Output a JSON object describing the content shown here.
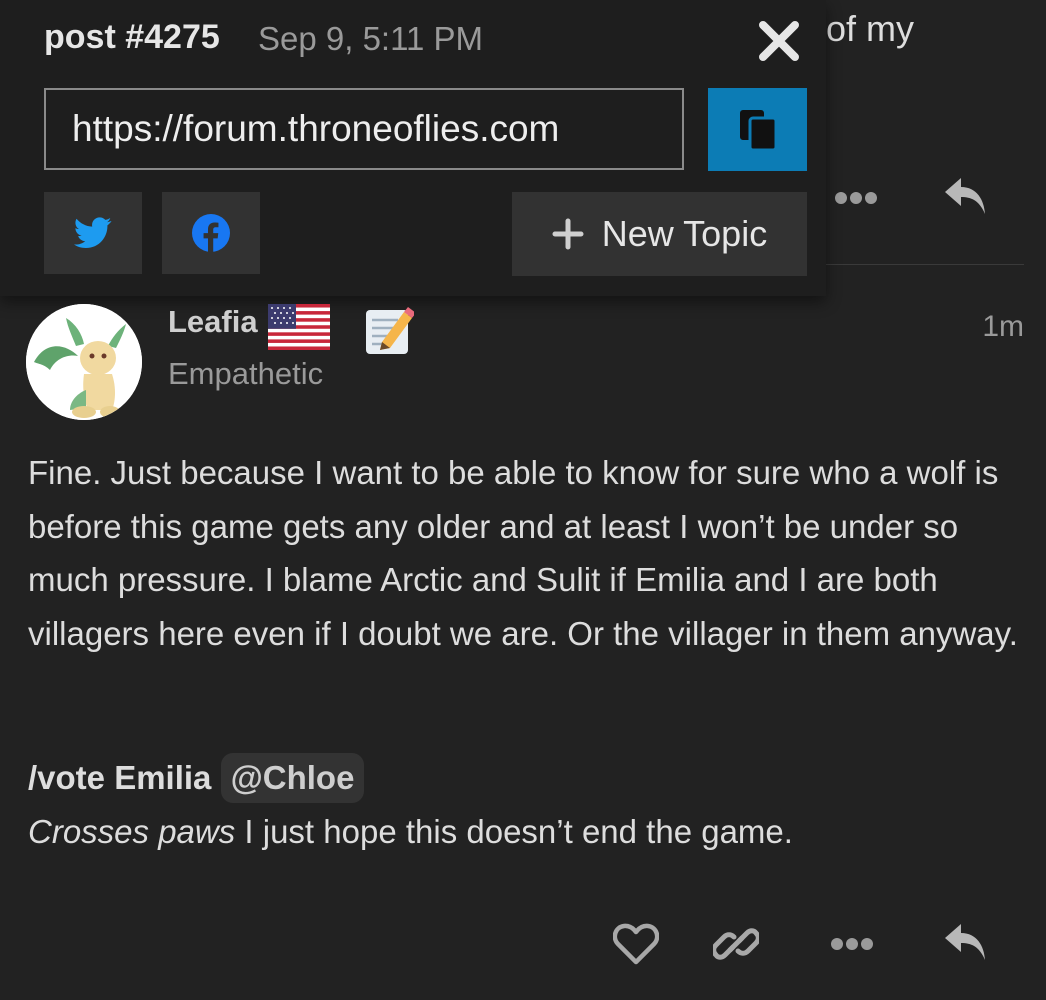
{
  "previous_post": {
    "visible_text": "of my"
  },
  "share_popup": {
    "post_label": "post #4275",
    "date": "Sep 9, 5:11 PM",
    "url": "https://forum.throneoflies.com",
    "new_topic_label": "New Topic",
    "colors": {
      "copy_button": "#0c7cb5",
      "twitter": "#1d9bf0",
      "facebook": "#1877f2"
    },
    "icons": [
      "close-icon",
      "copy-icon",
      "twitter-icon",
      "facebook-icon",
      "plus-icon"
    ]
  },
  "post": {
    "username": "Leafia",
    "user_title": "Empathetic",
    "time": "1m",
    "paragraph": "Fine. Just because I want to be able to know for sure who a wolf is before this game gets any older and at least I won’t be under so much pressure. I blame Arctic and Sulit if Emilia and I are both villagers here even if I doubt we are. Or the villager in them anyway.",
    "vote_command": "/vote Emilia",
    "mention": "@Chloe",
    "emphasis": "Crosses paws",
    "closing": " I just hope this doesn’t end the game.",
    "icons": [
      "flag-us-icon",
      "memo-pencil-icon",
      "heart-icon",
      "link-icon",
      "more-icon",
      "reply-icon"
    ]
  }
}
